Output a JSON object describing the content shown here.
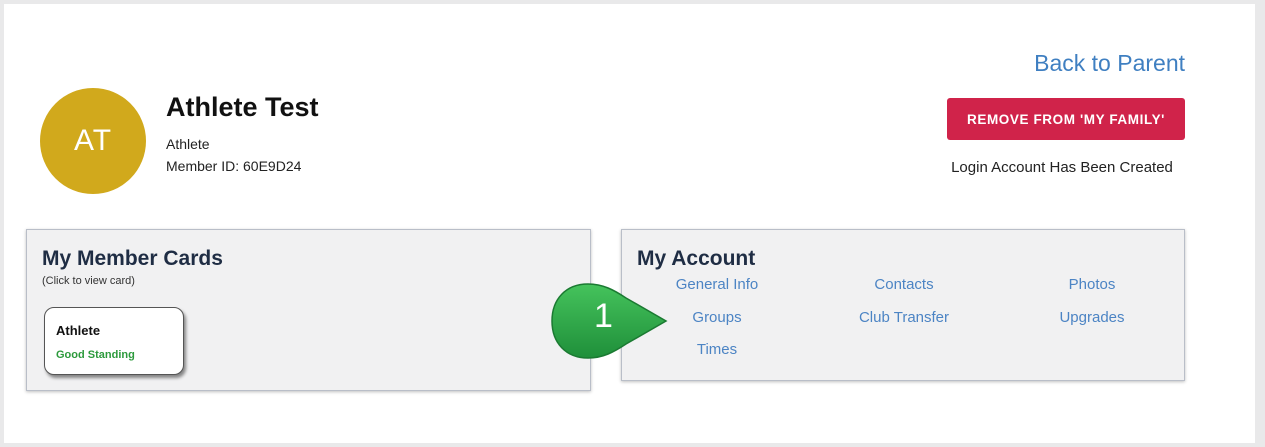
{
  "header": {
    "back_link": "Back to Parent",
    "avatar_initials": "AT",
    "name": "Athlete Test",
    "role": "Athlete",
    "member_id": "Member ID: 60E9D24",
    "remove_button": "REMOVE FROM 'MY FAMILY'",
    "login_status": "Login Account Has Been Created"
  },
  "member_cards": {
    "title": "My Member Cards",
    "subtitle": "(Click to view card)",
    "cards": [
      {
        "title": "Athlete",
        "status": "Good Standing"
      }
    ]
  },
  "account": {
    "title": "My Account",
    "links": [
      "General Info",
      "Contacts",
      "Photos",
      "Groups",
      "Club Transfer",
      "Upgrades",
      "Times"
    ]
  },
  "callout": {
    "number": "1"
  },
  "colors": {
    "avatar": "#d1a91c",
    "button": "#d0234a",
    "link": "#3f7fc1",
    "good_standing": "#2c9a3c",
    "callout": "#2ea84a"
  }
}
